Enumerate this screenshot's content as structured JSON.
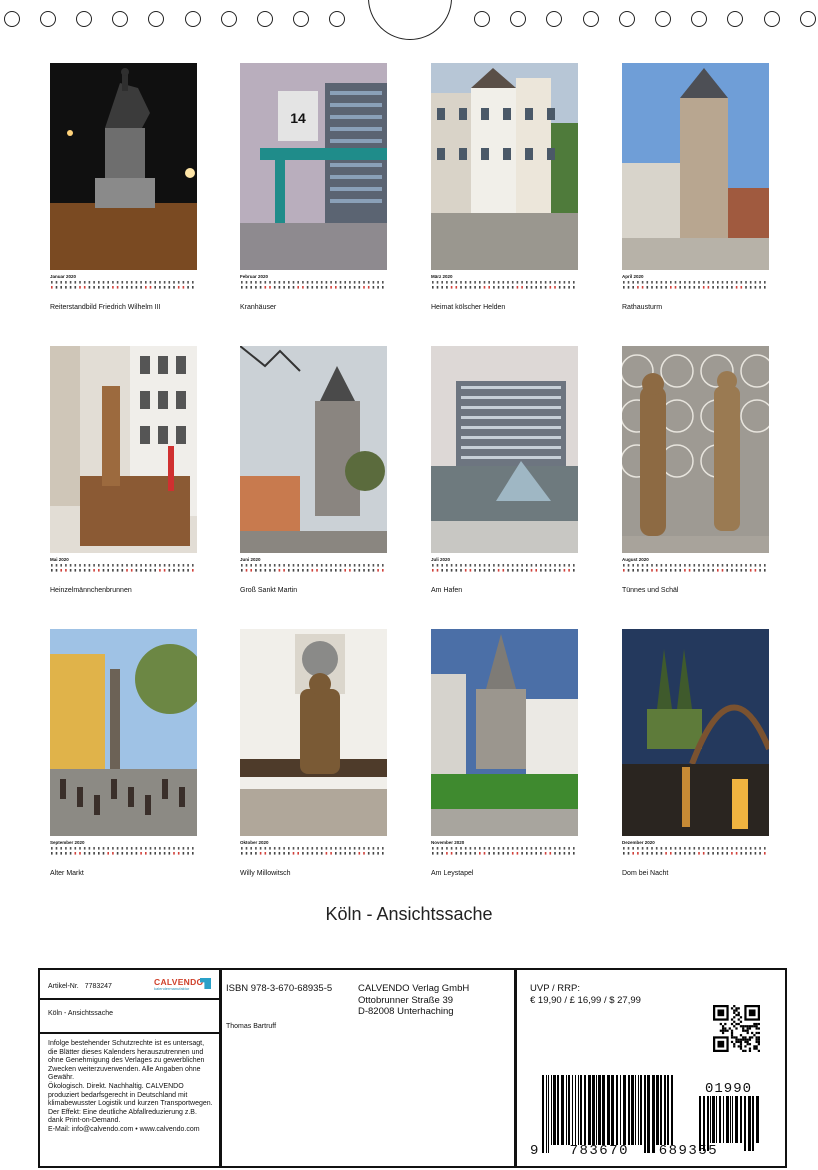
{
  "months": [
    {
      "name": "Januar 2020",
      "caption": "Reiterstandbild Friedrich Wilhelm III",
      "theme": "night-equestrian-statue"
    },
    {
      "name": "Februar 2020",
      "caption": "Kranhäuser",
      "theme": "crane-house-14"
    },
    {
      "name": "März 2020",
      "caption": "Heimat kölscher Helden",
      "theme": "old-town-houses"
    },
    {
      "name": "April 2020",
      "caption": "Rathausturm",
      "theme": "city-hall-tower"
    },
    {
      "name": "Mai 2020",
      "caption": "Heinzelmännchenbrunnen",
      "theme": "fountain"
    },
    {
      "name": "Juni 2020",
      "caption": "Groß Sankt Martin",
      "theme": "romanesque-church"
    },
    {
      "name": "Juli 2020",
      "caption": "Am Hafen",
      "theme": "harbour"
    },
    {
      "name": "August 2020",
      "caption": "Tünnes und Schäl",
      "theme": "bronze-figures"
    },
    {
      "name": "September 2020",
      "caption": "Alter Markt",
      "theme": "market-square"
    },
    {
      "name": "Oktober 2020",
      "caption": "Willy Millowitsch",
      "theme": "bench-statue"
    },
    {
      "name": "November 2020",
      "caption": "Am Leystapel",
      "theme": "riverside-cathedral"
    },
    {
      "name": "Dezember 2020",
      "caption": "Dom bei Nacht",
      "theme": "cathedral-night"
    }
  ],
  "photo_label_crane": "14",
  "title": "Köln - Ansichtssache",
  "info": {
    "article_label": "Artikel-Nr.",
    "article_number": "7783247",
    "brand": "CALVENDO",
    "brand_tagline": "kalendermanufaktur",
    "product_title": "Köln - Ansichtssache",
    "disclaimer": "Infolge bestehender Schutzrechte ist es untersagt, die Blätter dieses Kalenders herauszutrennen und ohne Genehmigung des Verlages zu gewerblichen Zwecken weiterzuverwenden. Alle Angaben ohne Gewähr.",
    "eco": "Ökologisch. Direkt. Nachhaltig. CALVENDO produziert bedarfsgerecht in Deutschland mit klimabewusster Logistik und kurzen Transportwegen. Der Effekt: Eine deutliche Abfallreduzierung z.B. dank Print-on-Demand.",
    "email": "E-Mail: info@calvendo.com • www.calvendo.com",
    "isbn": "ISBN 978-3-670-68935-5",
    "author": "Thomas Bartruff",
    "publisher_name": "CALVENDO Verlag GmbH",
    "publisher_street": "Ottobrunner Straße 39",
    "publisher_city": "D-82008 Unterhaching",
    "price_label": "UVP / RRP:",
    "price": "€ 19,90 / £ 16,99 / $ 27,99",
    "barcode_digits": "9   783670   689355",
    "addon_digits": "01990"
  }
}
